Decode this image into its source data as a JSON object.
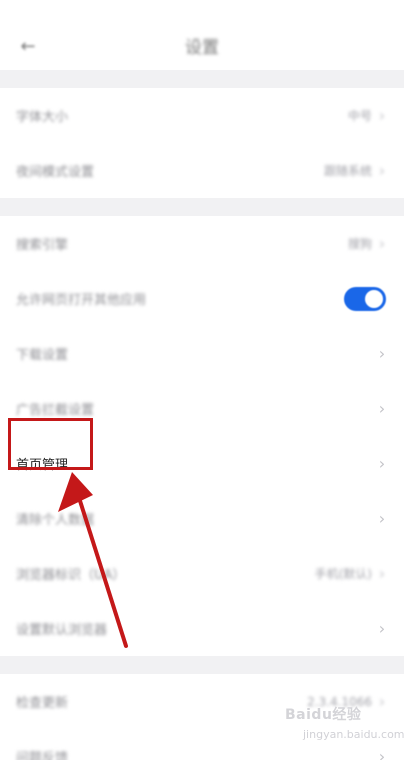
{
  "header": {
    "back_icon": "back-arrow-icon",
    "title": "设置"
  },
  "settings": {
    "group1": [
      {
        "label": "字体大小",
        "value": "中号",
        "icon": "chevron-right-icon"
      },
      {
        "label": "夜间模式设置",
        "value": "跟随系统",
        "icon": "chevron-right-icon"
      }
    ],
    "group2": [
      {
        "label": "搜索引擎",
        "value": "搜狗",
        "icon": "chevron-right-icon"
      },
      {
        "label": "允许网页打开其他应用",
        "value": "",
        "toggle": true,
        "toggle_color": "#1a67e8"
      },
      {
        "label": "下载设置",
        "value": "",
        "icon": "chevron-right-icon"
      },
      {
        "label": "广告拦截设置",
        "value": "",
        "icon": "chevron-right-icon"
      },
      {
        "label": "首页管理",
        "value": "",
        "icon": "chevron-right-icon",
        "highlighted": true
      },
      {
        "label": "清除个人数据",
        "value": "",
        "icon": "chevron-right-icon"
      },
      {
        "label": "浏览器标识（UA）",
        "value": "手机(默认)",
        "icon": "chevron-right-icon"
      },
      {
        "label": "设置默认浏览器",
        "value": "",
        "icon": "chevron-right-icon"
      }
    ],
    "group3": [
      {
        "label": "检查更新",
        "value": "2.3.4.1066",
        "icon": "chevron-right-icon"
      },
      {
        "label": "问题反馈",
        "value": "",
        "icon": "chevron-right-icon"
      }
    ]
  },
  "annotation": {
    "highlight_color": "#c41819",
    "arrow_color": "#c41819"
  },
  "watermark": {
    "brand": "Baidu经验",
    "url": "jingyan.baidu.com"
  }
}
